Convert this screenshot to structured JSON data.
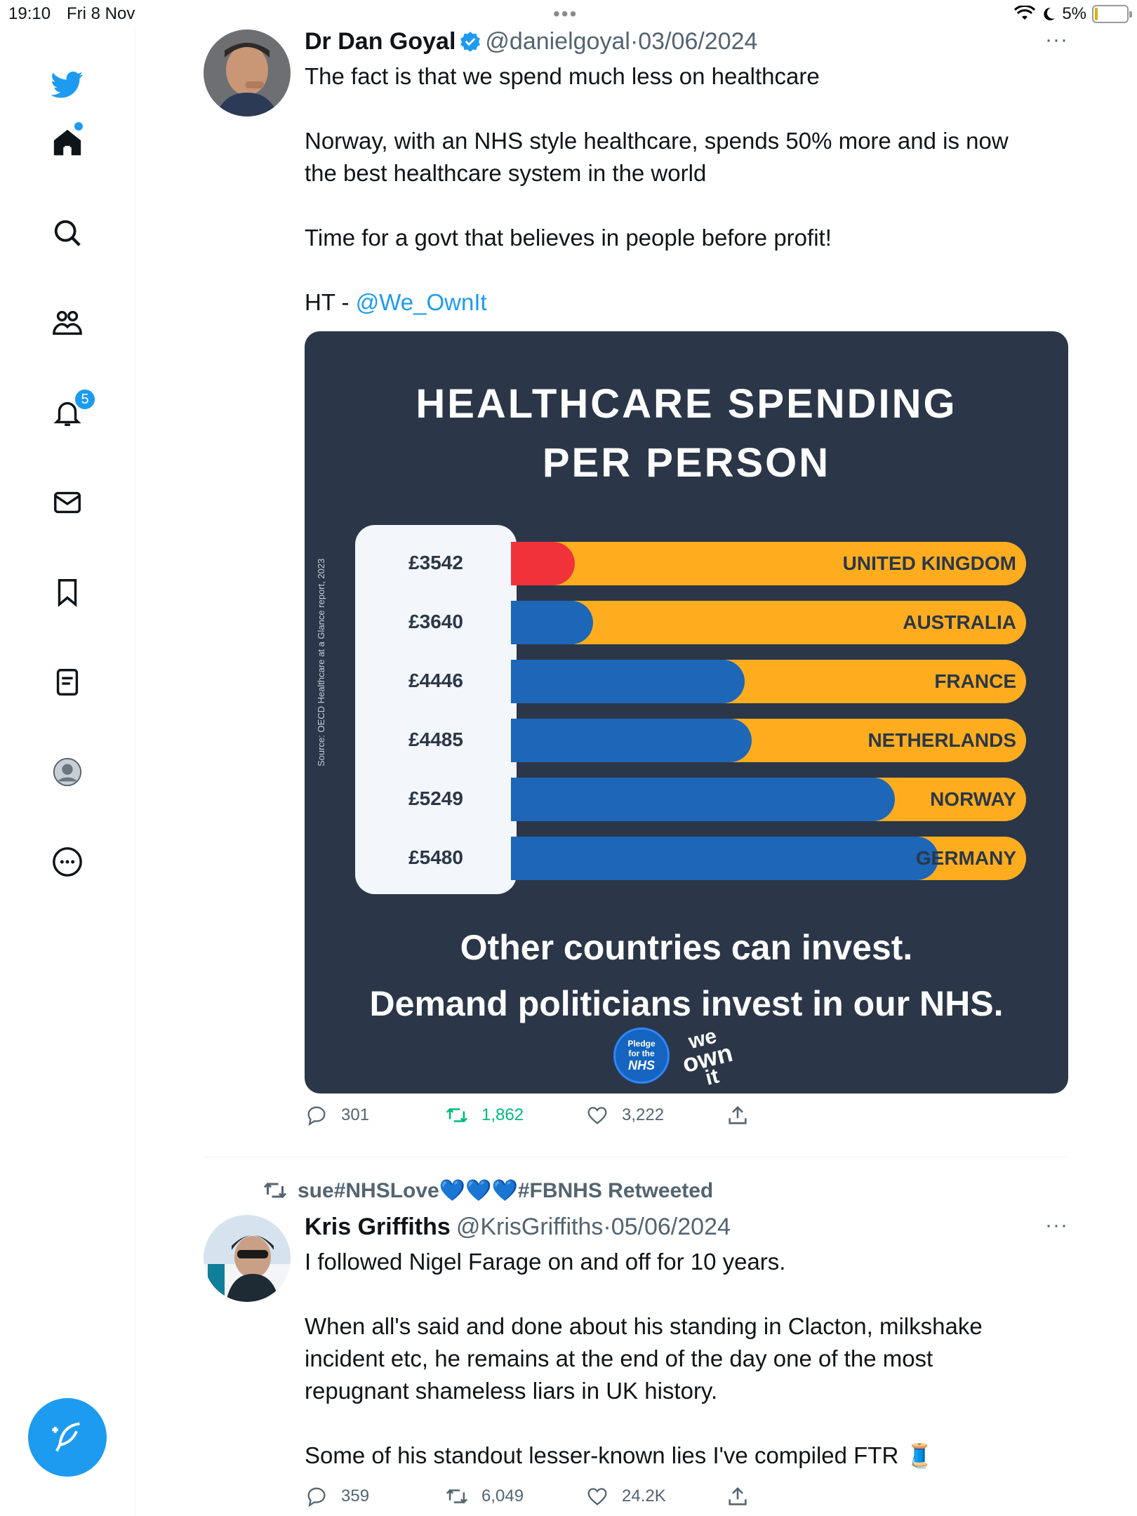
{
  "status": {
    "time": "19:10",
    "date": "Fri 8 Nov",
    "battery": "5%"
  },
  "sidebar": {
    "notifications_badge": "5"
  },
  "tweet1": {
    "name": "Dr Dan Goyal",
    "handle": "@danielgoyal",
    "sep": "·",
    "date": "03/06/2024",
    "more": "···",
    "lines": [
      "The fact is that we spend much less on healthcare",
      "",
      "Norway, with an NHS style healthcare, spends 50% more and is now",
      "the best healthcare system in the world",
      "",
      "Time for a govt that believes in people before profit!",
      "",
      "HT - "
    ],
    "mention": "@We_OwnIt",
    "replies": "301",
    "retweets": "1,862",
    "likes": "3,222"
  },
  "chart_data": {
    "type": "bar",
    "title": "HEALTHCARE SPENDING",
    "subtitle": "PER PERSON",
    "source": "Source: OECD Healthcare at a Glance report, 2023",
    "categories": [
      "UNITED KINGDOM",
      "AUSTRALIA",
      "FRANCE",
      "NETHERLANDS",
      "NORWAY",
      "GERMANY"
    ],
    "value_labels": [
      "£3542",
      "£3640",
      "£4446",
      "£4485",
      "£5249",
      "£5480"
    ],
    "values": [
      3542,
      3640,
      4446,
      4485,
      5249,
      5480
    ],
    "colors": [
      "#f0333b",
      "#1d66b8",
      "#1d66b8",
      "#1d66b8",
      "#1d66b8",
      "#1d66b8"
    ],
    "track_color": "#ffad1f",
    "footer_line1": "Other countries can invest.",
    "footer_line2": "Demand politicians invest in our NHS.",
    "logo1": [
      "Pledge",
      "for the",
      "NHS"
    ],
    "logo2": [
      "we",
      "own",
      "it"
    ]
  },
  "retweet_banner": {
    "text": "sue#NHSLove",
    "hearts": "💙💙💙",
    "tail": "#FBNHS Retweeted"
  },
  "tweet2": {
    "name": "Kris Griffiths",
    "handle": "@KrisGriffiths",
    "sep": "·",
    "date": "05/06/2024",
    "more": "···",
    "lines": [
      "I followed Nigel Farage on and off for 10 years.",
      "",
      "When all's said and done about his standing in Clacton, milkshake",
      "incident etc, he remains at the end of the day one of the most",
      "repugnant shameless liars in UK history.",
      "",
      "Some of his standout lesser-known lies I've compiled FTR 🧵"
    ],
    "replies": "359",
    "retweets": "6,049",
    "likes": "24.2K"
  }
}
